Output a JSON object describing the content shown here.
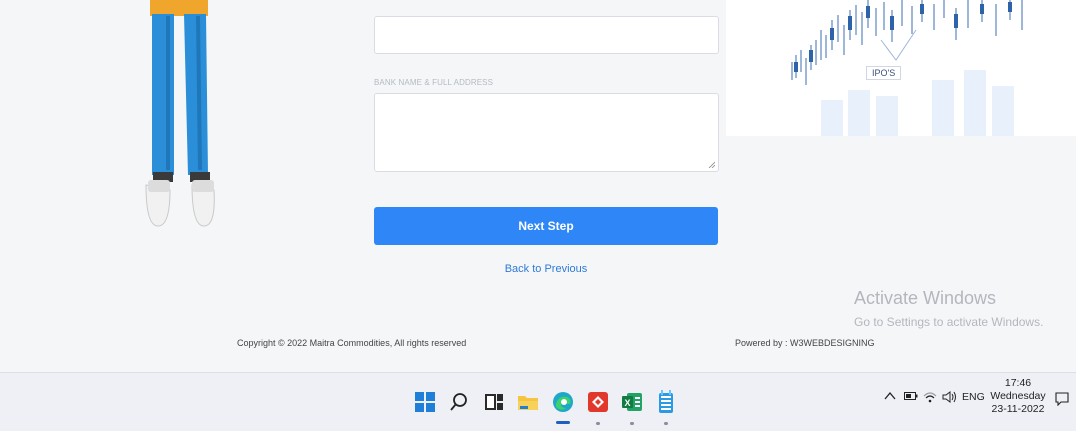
{
  "form": {
    "bank_label": "BANK NAME & FULL ADDRESS",
    "next_button": "Next Step",
    "back_link": "Back to Previous"
  },
  "banner": {
    "label": "IPO'S"
  },
  "footer": {
    "copyright": "Copyright © 2022 Maitra Commodities, All rights reserved",
    "powered_by": "Powered by : W3WEBDESIGNING"
  },
  "watermark": {
    "title": "Activate Windows",
    "subtitle": "Go to Settings to activate Windows."
  },
  "taskbar": {
    "apps": [
      "windows-start-icon",
      "search-icon",
      "task-view-icon",
      "file-explorer-icon",
      "edge-icon",
      "anydesk-icon",
      "excel-icon",
      "notepad-icon"
    ],
    "tray": {
      "language": "ENG"
    },
    "clock": {
      "time": "17:46",
      "day": "Wednesday",
      "date": "23-11-2022"
    }
  },
  "colors": {
    "primary": "#2e86f7",
    "link": "#2e7bd6",
    "page_bg": "#f5f6f8"
  }
}
